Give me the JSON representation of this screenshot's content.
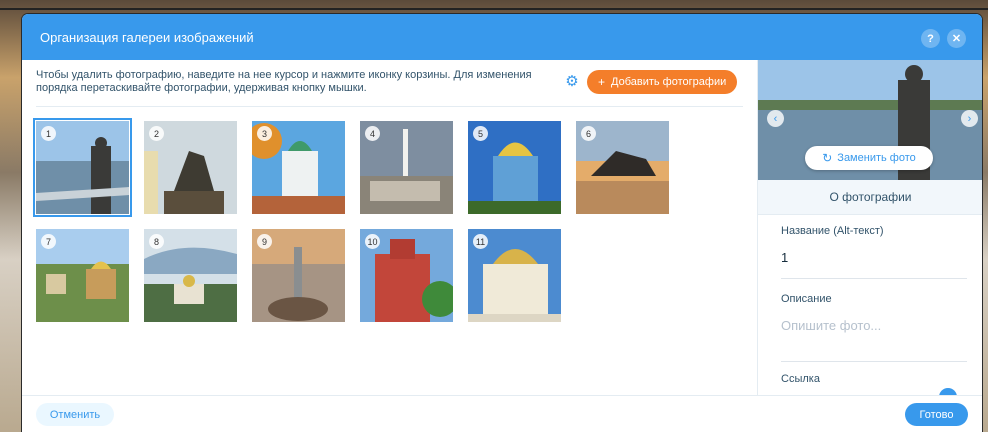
{
  "dialog": {
    "title": "Организация галереи изображений",
    "help_icon": "?",
    "close_icon": "✕"
  },
  "toolbar": {
    "instructions": "Чтобы удалить фотографию, наведите на нее курсор и нажмите иконку корзины. Для изменения порядка перетаскивайте фотографии, удерживая кнопку мышки.",
    "add_photos_label": "Добавить фотографии",
    "add_icon": "+"
  },
  "gallery": {
    "items": [
      {
        "number": "1",
        "selected": true
      },
      {
        "number": "2",
        "selected": false
      },
      {
        "number": "3",
        "selected": false
      },
      {
        "number": "4",
        "selected": false
      },
      {
        "number": "5",
        "selected": false
      },
      {
        "number": "6",
        "selected": false
      },
      {
        "number": "7",
        "selected": false
      },
      {
        "number": "8",
        "selected": false
      },
      {
        "number": "9",
        "selected": false
      },
      {
        "number": "10",
        "selected": false
      },
      {
        "number": "11",
        "selected": false
      }
    ]
  },
  "details": {
    "replace_label": "Заменить фото",
    "section_title": "О фотографии",
    "alt_label": "Название (Alt-текст)",
    "alt_value": "1",
    "description_label": "Описание",
    "description_placeholder": "Опишите фото...",
    "link_label": "Ссылка"
  },
  "footer": {
    "cancel_label": "Отменить",
    "done_label": "Готово"
  },
  "colors": {
    "accent": "#3899ec",
    "add_button": "#f47e2a"
  }
}
